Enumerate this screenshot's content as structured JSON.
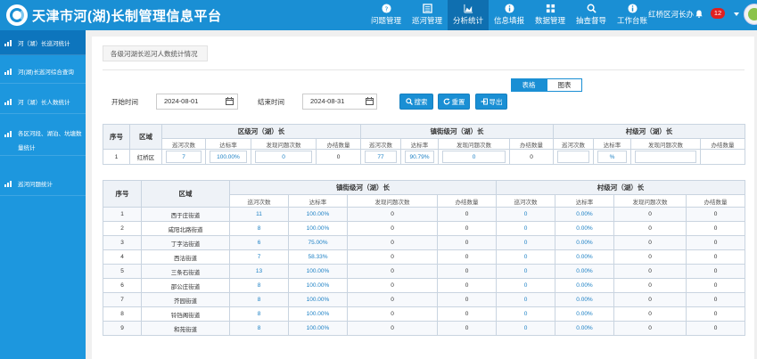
{
  "header": {
    "title": "天津市河(湖)长制管理信息平台",
    "nav": [
      {
        "label": "问题管理",
        "icon": "question-icon",
        "active": false
      },
      {
        "label": "巡河管理",
        "icon": "list-icon",
        "active": false
      },
      {
        "label": "分析统计",
        "icon": "chart-icon",
        "active": true
      },
      {
        "label": "信息填报",
        "icon": "info-icon",
        "active": false
      },
      {
        "label": "数据管理",
        "icon": "grid-icon",
        "active": false
      },
      {
        "label": "抽查督导",
        "icon": "search-icon",
        "active": false
      },
      {
        "label": "工作台账",
        "icon": "info-icon",
        "active": false
      }
    ],
    "user": "红桥区河长办",
    "badge": "12"
  },
  "sidebar": {
    "items": [
      {
        "label": "河（湖）长巡河统计",
        "active": true
      },
      {
        "label": "河(湖)长巡河综合查询",
        "active": false
      },
      {
        "label": "河（湖）长人数统计",
        "active": false
      },
      {
        "label": "各区河段、湖泊、坑塘数量统计",
        "active": false
      },
      {
        "label": "巡河问题统计",
        "active": false
      }
    ]
  },
  "breadcrumb": "各级河湖长巡河人数统计情况",
  "view_toggle": {
    "table": "表格",
    "chart": "图表"
  },
  "filters": {
    "start_label": "开始时间",
    "start_value": "2024-08-01",
    "end_label": "结束时间",
    "end_value": "2024-08-31",
    "search": "搜索",
    "reset": "重置",
    "export": "导出"
  },
  "table1": {
    "col_index": "序号",
    "col_area": "区域",
    "groups": [
      "区级河（湖）长",
      "镇街级河（湖）长",
      "村级河（湖）长"
    ],
    "subcols": [
      "巡河次数",
      "达标率",
      "发现问题次数",
      "办结数量"
    ],
    "rows": [
      {
        "index": "1",
        "area": "红桥区",
        "values": [
          "7",
          "100.00%",
          "0",
          "0",
          "77",
          "90.79%",
          "0",
          "0",
          "",
          "%",
          "",
          ""
        ]
      }
    ]
  },
  "table2": {
    "col_index": "序号",
    "col_area": "区域",
    "groups": [
      "镇街级河（湖）长",
      "村级河（湖）长"
    ],
    "subcols": [
      "巡河次数",
      "达标率",
      "发现问题次数",
      "办结数量"
    ],
    "rows": [
      {
        "index": "1",
        "area": "西于庄街道",
        "values": [
          "11",
          "100.00%",
          "0",
          "0",
          "0",
          "0.00%",
          "0",
          "0"
        ]
      },
      {
        "index": "2",
        "area": "咸阳北路街道",
        "values": [
          "8",
          "100.00%",
          "0",
          "0",
          "0",
          "0.00%",
          "0",
          "0"
        ]
      },
      {
        "index": "3",
        "area": "丁字沽街道",
        "values": [
          "6",
          "75.00%",
          "0",
          "0",
          "0",
          "0.00%",
          "0",
          "0"
        ]
      },
      {
        "index": "4",
        "area": "西沽街道",
        "values": [
          "7",
          "58.33%",
          "0",
          "0",
          "0",
          "0.00%",
          "0",
          "0"
        ]
      },
      {
        "index": "5",
        "area": "三条石街道",
        "values": [
          "13",
          "100.00%",
          "0",
          "0",
          "0",
          "0.00%",
          "0",
          "0"
        ]
      },
      {
        "index": "6",
        "area": "邵公庄街道",
        "values": [
          "8",
          "100.00%",
          "0",
          "0",
          "0",
          "0.00%",
          "0",
          "0"
        ]
      },
      {
        "index": "7",
        "area": "芥园街道",
        "values": [
          "8",
          "100.00%",
          "0",
          "0",
          "0",
          "0.00%",
          "0",
          "0"
        ]
      },
      {
        "index": "8",
        "area": "铃铛阁街道",
        "values": [
          "8",
          "100.00%",
          "0",
          "0",
          "0",
          "0.00%",
          "0",
          "0"
        ]
      },
      {
        "index": "9",
        "area": "和苑街道",
        "values": [
          "8",
          "100.00%",
          "0",
          "0",
          "0",
          "0.00%",
          "0",
          "0"
        ]
      }
    ]
  },
  "colors": {
    "header_bg": "#1a8fd4",
    "sidebar_bg": "#1d97de",
    "active_bg": "#0d75bd",
    "badge": "#e02020"
  }
}
